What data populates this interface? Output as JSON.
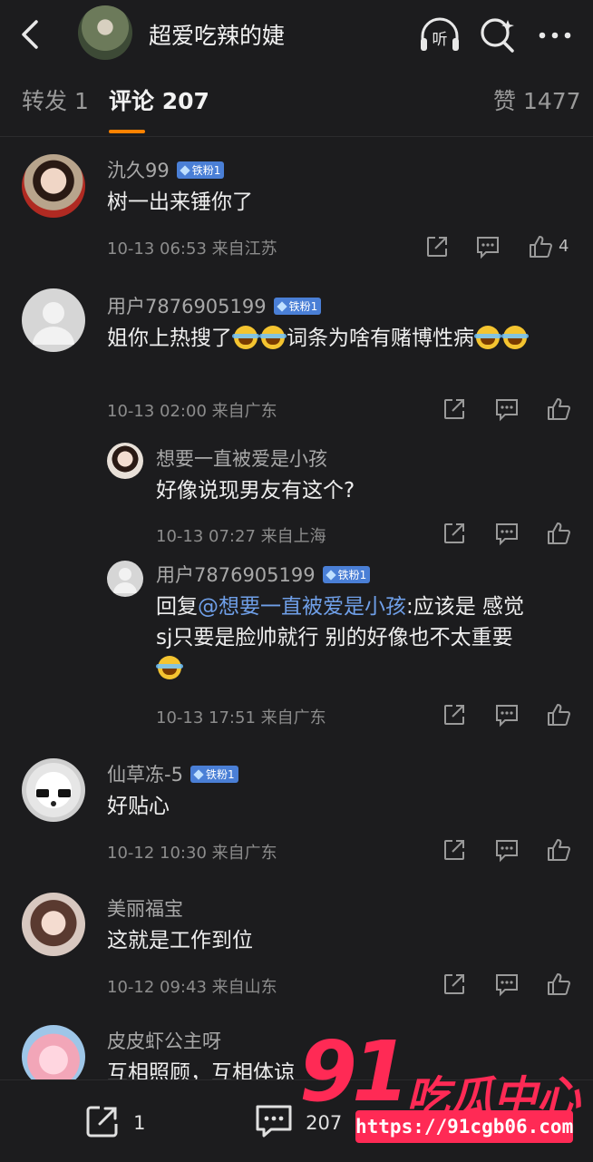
{
  "header": {
    "title": "超爱吃辣的婕",
    "listen_label": "听"
  },
  "tabs": [
    {
      "label": "转发 1"
    },
    {
      "label": "评论 207"
    },
    {
      "label": "赞 1477"
    }
  ],
  "comments": [
    {
      "user": "氿久99",
      "badge": "铁粉1",
      "text": "树一出来锤你了",
      "time": "10-13 06:53",
      "location": "来自江苏",
      "likes": "4"
    },
    {
      "user": "用户7876905199",
      "badge": "铁粉1",
      "text": "姐你上热搜了",
      "text2": "词条为啥有赌博性病",
      "time": "10-13 02:00",
      "location": "来自广东"
    },
    {
      "user": "想要一直被爱是小孩",
      "text": "好像说现男友有这个?",
      "time": "10-13 07:27",
      "location": "来自上海"
    },
    {
      "user": "用户7876905199",
      "badge": "铁粉1",
      "reply_prefix": "回复",
      "mention": "@想要一直被爱是小孩",
      "text": ":应该是 感觉",
      "text2": "sj只要是脸帅就行 别的好像也不太重要",
      "time": "10-13 17:51",
      "location": "来自广东"
    },
    {
      "user": "仙草冻-5",
      "badge": "铁粉1",
      "text": "好贴心",
      "time": "10-12 10:30",
      "location": "来自广东"
    },
    {
      "user": "美丽福宝",
      "text": "这就是工作到位",
      "time": "10-12 09:43",
      "location": "来自山东"
    },
    {
      "user": "皮皮虾公主呀",
      "text": "互相照顾，互相体谅"
    }
  ],
  "bottom": {
    "repost_count": "1",
    "comment_count": "207"
  },
  "watermark": {
    "big": "91",
    "name": "吃瓜中心",
    "url": "https://91cgb06.com"
  },
  "colors": {
    "background": "#1c1c1e",
    "accent": "#ff8200",
    "badge": "#4a7fd6",
    "mention": "#6f9fe8",
    "watermark": "#ff2a55"
  },
  "icons": [
    "back-icon",
    "listen-icon",
    "search-icon",
    "more-icon",
    "share-icon",
    "comment-icon",
    "like-icon"
  ]
}
